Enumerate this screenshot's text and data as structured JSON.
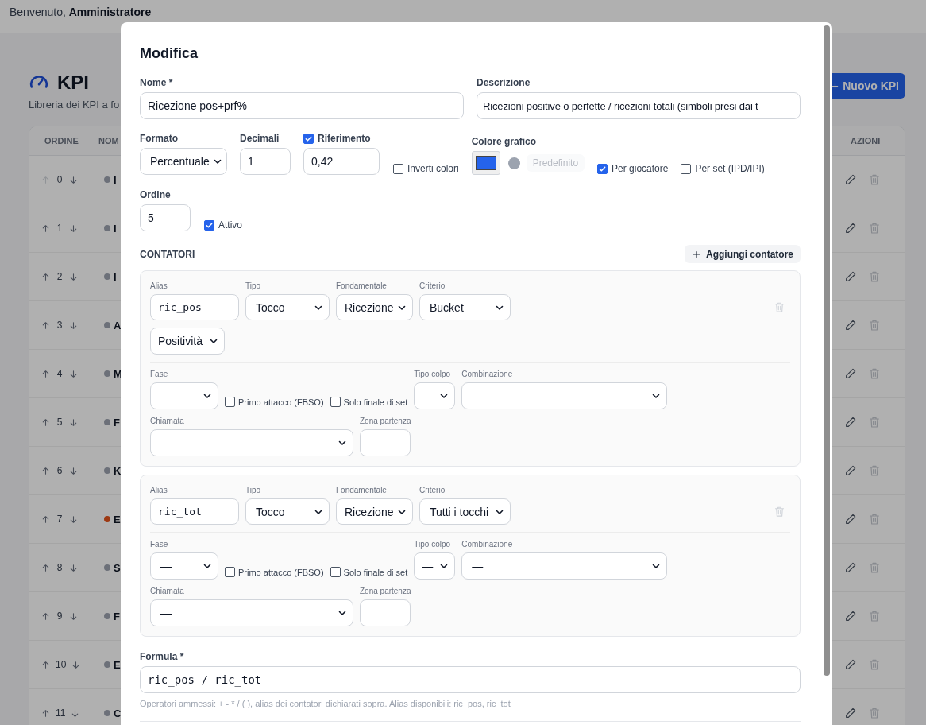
{
  "header": {
    "greeting": "Benvenuto,",
    "user": "Amministratore"
  },
  "page": {
    "title": "KPI",
    "subtitle": "Libreria dei KPI a fo",
    "new_button": "Nuovo KPI"
  },
  "table": {
    "columns": [
      "ORDINE",
      "NOM",
      "AZIONI"
    ],
    "rows": [
      {
        "order": "0",
        "color": "#6c7079",
        "name": "I",
        "up_disabled": true
      },
      {
        "order": "1",
        "color": "#6c7079",
        "name": "I",
        "up_disabled": false
      },
      {
        "order": "2",
        "color": "#6c7079",
        "name": "I",
        "up_disabled": false
      },
      {
        "order": "3",
        "color": "#6c7079",
        "name": "A",
        "up_disabled": false
      },
      {
        "order": "4",
        "color": "#6c7079",
        "name": "M",
        "up_disabled": false
      },
      {
        "order": "5",
        "color": "#6c7079",
        "name": "F",
        "up_disabled": false
      },
      {
        "order": "6",
        "color": "#6c7079",
        "name": "K",
        "up_disabled": false
      },
      {
        "order": "7",
        "color": "#9d3913",
        "name": "E",
        "up_disabled": false
      },
      {
        "order": "8",
        "color": "#6c7079",
        "name": "S",
        "up_disabled": false
      },
      {
        "order": "9",
        "color": "#6c7079",
        "name": "F",
        "up_disabled": false
      },
      {
        "order": "10",
        "color": "#6c7079",
        "name": "E",
        "up_disabled": false
      },
      {
        "order": "11",
        "color": "#6c7079",
        "name": "C",
        "up_disabled": false
      }
    ]
  },
  "modal": {
    "title": "Modifica",
    "nome": {
      "label": "Nome *",
      "value": "Ricezione pos+prf%"
    },
    "descrizione": {
      "label": "Descrizione",
      "value": "Ricezioni positive o perfette / ricezioni totali (simboli presi dai t"
    },
    "formato": {
      "label": "Formato",
      "value": "Percentuale"
    },
    "decimali": {
      "label": "Decimali",
      "value": "1"
    },
    "riferimento": {
      "label": "Riferimento",
      "checked": true,
      "value": "0,42"
    },
    "inverti_colori": {
      "label": "Inverti colori",
      "checked": false
    },
    "colore_grafico": {
      "label": "Colore grafico",
      "color": "#2563eb",
      "default_button": {
        "label": "Predefinito",
        "disabled": true
      }
    },
    "per_giocatore": {
      "label": "Per giocatore",
      "checked": true
    },
    "per_set": {
      "label": "Per set (IPD/IPI)",
      "checked": false
    },
    "ordine": {
      "label": "Ordine",
      "value": "5"
    },
    "attivo": {
      "label": "Attivo",
      "checked": true
    },
    "counters_section": {
      "title": "CONTATORI",
      "add_button": "Aggiungi contatore"
    },
    "counters": [
      {
        "main": [
          {
            "kind": "text",
            "label": "Alias",
            "value": "ric_pos"
          },
          {
            "kind": "select",
            "label": "Tipo",
            "value": "Tocco"
          },
          {
            "kind": "select",
            "label": "Fondamentale",
            "value": "Ricezione"
          },
          {
            "kind": "select",
            "label": "Criterio",
            "value": "Bucket"
          }
        ],
        "extra": [
          {
            "kind": "select",
            "value": "Positività"
          }
        ],
        "filters": [
          {
            "kind": "select",
            "label": "Fase",
            "value": "—"
          },
          {
            "kind": "checkbox",
            "label": "Primo attacco (FBSO)",
            "checked": false
          },
          {
            "kind": "checkbox",
            "label": "Solo finale di set",
            "checked": false
          },
          {
            "kind": "select",
            "label": "Tipo colpo",
            "value": "—"
          },
          {
            "kind": "select",
            "label": "Combinazione",
            "value": "—"
          }
        ],
        "location": [
          {
            "kind": "select",
            "label": "Chiamata",
            "value": "—"
          },
          {
            "kind": "text",
            "label": "Zona partenza"
          }
        ]
      },
      {
        "main": [
          {
            "kind": "text",
            "label": "Alias",
            "value": "ric_tot"
          },
          {
            "kind": "select",
            "label": "Tipo",
            "value": "Tocco"
          },
          {
            "kind": "select",
            "label": "Fondamentale",
            "value": "Ricezione"
          },
          {
            "kind": "select",
            "label": "Criterio",
            "value": "Tutti i tocchi"
          }
        ],
        "filters": [
          {
            "kind": "select",
            "label": "Fase",
            "value": "—"
          },
          {
            "kind": "checkbox",
            "label": "Primo attacco (FBSO)",
            "checked": false
          },
          {
            "kind": "checkbox",
            "label": "Solo finale di set",
            "checked": false
          },
          {
            "kind": "select",
            "label": "Tipo colpo",
            "value": "—"
          },
          {
            "kind": "select",
            "label": "Combinazione",
            "value": "—"
          }
        ],
        "location": [
          {
            "kind": "select",
            "label": "Chiamata",
            "value": "—"
          },
          {
            "kind": "text",
            "label": "Zona partenza"
          }
        ]
      }
    ],
    "formula": {
      "label": "Formula *",
      "value": "ric_pos / ric_tot",
      "hint": "Operatori ammessi: + - * / ( ), alias dei contatori dichiarati sopra. Alias disponibili: ric_pos, ric_tot"
    }
  }
}
